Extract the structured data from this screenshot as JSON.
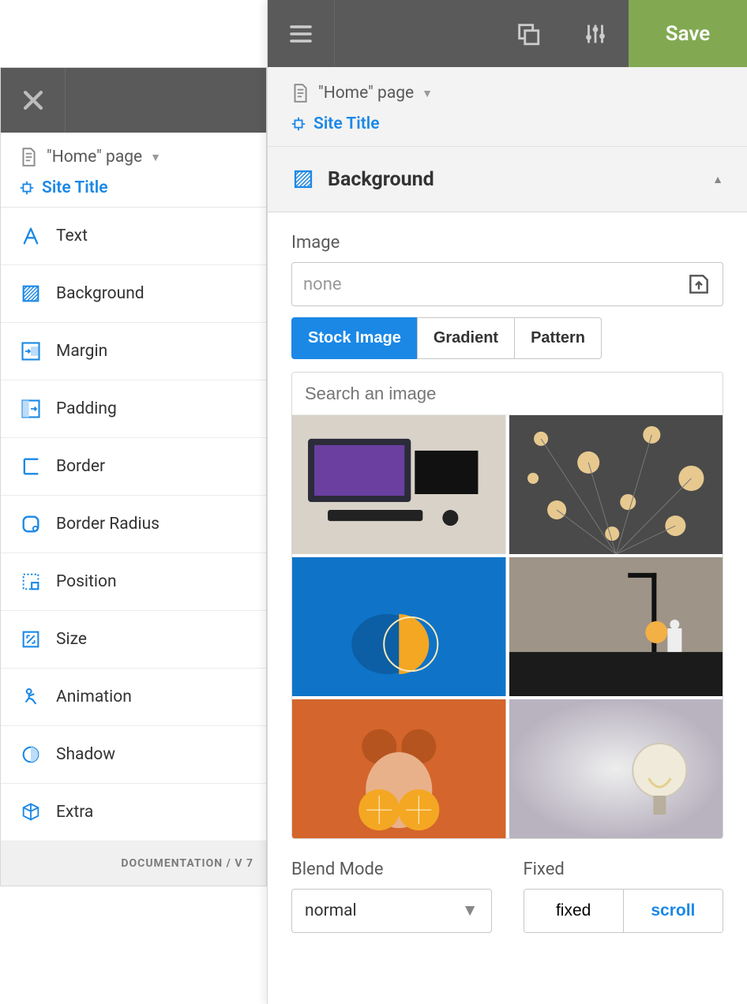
{
  "left": {
    "breadcrumb_page": "\"Home\" page",
    "breadcrumb_site": "Site Title",
    "props": [
      {
        "label": "Text",
        "icon": "text-icon"
      },
      {
        "label": "Background",
        "icon": "background-icon"
      },
      {
        "label": "Margin",
        "icon": "margin-icon"
      },
      {
        "label": "Padding",
        "icon": "padding-icon"
      },
      {
        "label": "Border",
        "icon": "border-icon"
      },
      {
        "label": "Border Radius",
        "icon": "border-radius-icon"
      },
      {
        "label": "Position",
        "icon": "position-icon"
      },
      {
        "label": "Size",
        "icon": "size-icon"
      },
      {
        "label": "Animation",
        "icon": "animation-icon"
      },
      {
        "label": "Shadow",
        "icon": "shadow-icon"
      },
      {
        "label": "Extra",
        "icon": "extra-icon"
      }
    ],
    "footer": "DOCUMENTATION / V 7"
  },
  "right": {
    "save_label": "Save",
    "breadcrumb_page": "\"Home\" page",
    "breadcrumb_site": "Site Title",
    "section_title": "Background",
    "image_label": "Image",
    "image_value": "none",
    "tabs": {
      "stock": "Stock Image",
      "gradient": "Gradient",
      "pattern": "Pattern"
    },
    "search_placeholder": "Search an image",
    "blend_label": "Blend Mode",
    "blend_value": "normal",
    "fixed_label": "Fixed",
    "fixed_option": "fixed",
    "scroll_option": "scroll"
  },
  "colors": {
    "accent": "#1b88e6",
    "save_green": "#82a952"
  }
}
